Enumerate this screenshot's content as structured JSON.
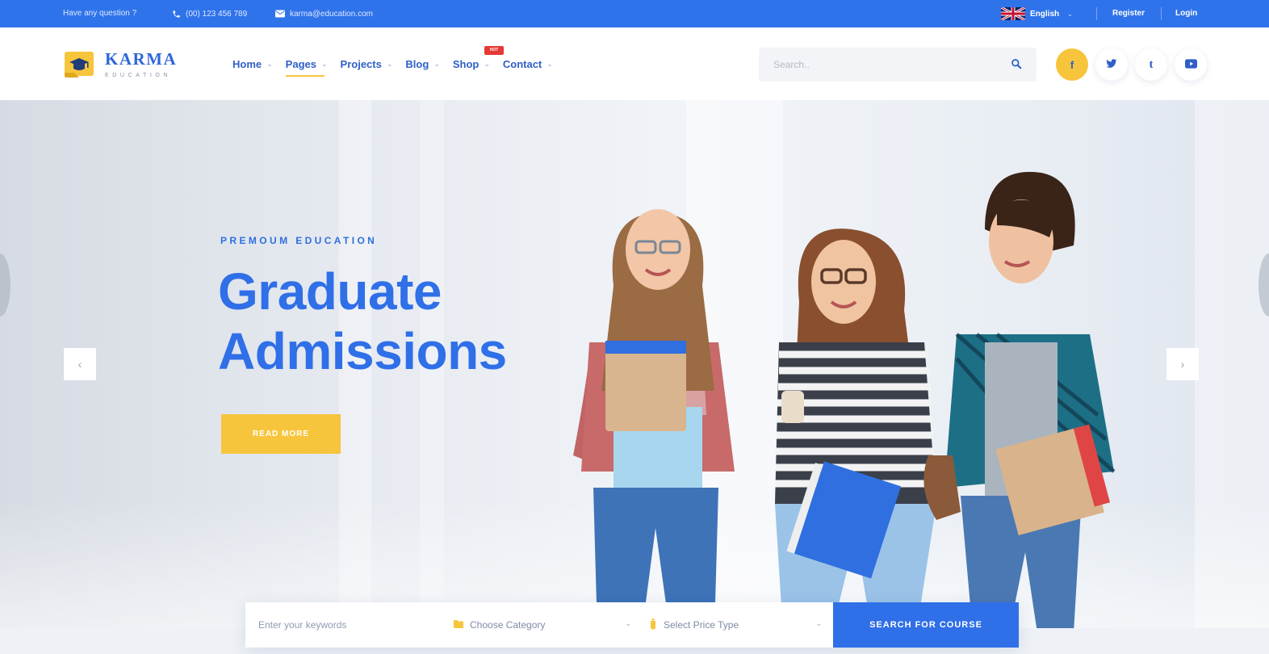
{
  "topbar": {
    "question": "Have any question ?",
    "phone": "(00) 123 456 789",
    "email": "karma@education.com",
    "language": "English",
    "register": "Register",
    "login": "Login"
  },
  "header": {
    "logo_name": "KARMA",
    "logo_tagline": "EDUCATION",
    "nav": [
      {
        "label": "Home"
      },
      {
        "label": "Pages"
      },
      {
        "label": "Projects"
      },
      {
        "label": "Blog"
      },
      {
        "label": "Shop"
      },
      {
        "label": "Contact"
      }
    ],
    "hot_badge": "HOT",
    "search_placeholder": "Search..",
    "social": {
      "facebook": "f",
      "twitter": "twitter-icon",
      "tumblr": "t",
      "youtube": "youtube-icon"
    }
  },
  "hero": {
    "subtitle": "PREMOUM EDUCATION",
    "title_line1": "Graduate",
    "title_line2": "Admissions",
    "button": "READ MORE"
  },
  "course_search": {
    "keyword_placeholder": "Enter your keywords",
    "category": "Choose Category",
    "price": "Select Price Type",
    "button": "SEARCH FOR COURSE"
  },
  "colors": {
    "primary": "#2f73ea",
    "accent": "#f7c53c",
    "hot": "#e53935"
  }
}
